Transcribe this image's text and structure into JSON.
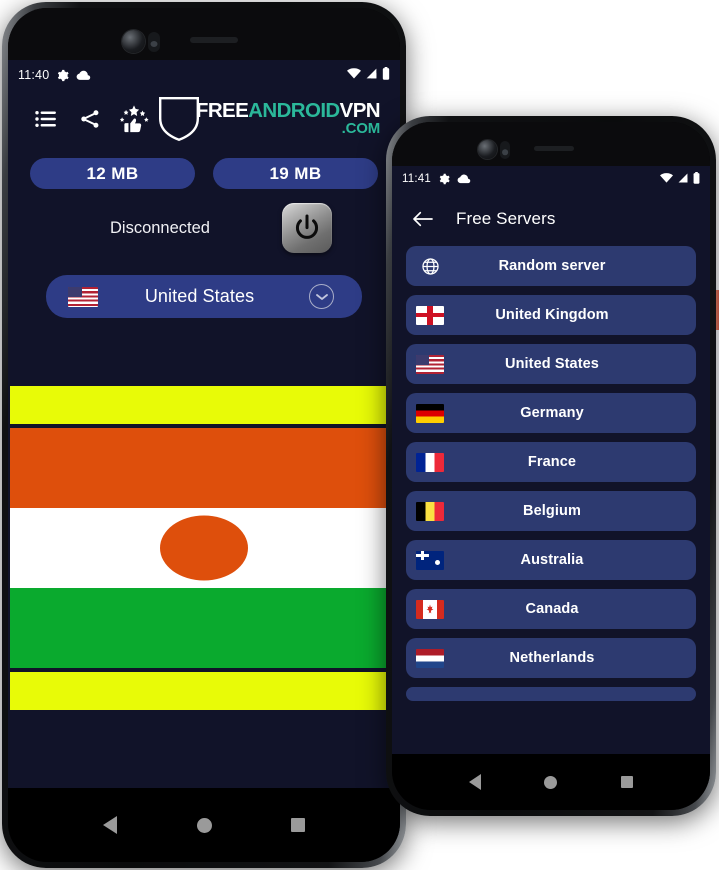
{
  "meta": {
    "bg_dark": "#111329",
    "accent_blue": "#2e3c86",
    "list_blue": "#2d3a70",
    "logo_teal": "#2bb89a"
  },
  "phone1": {
    "status_bar": {
      "time": "11:40",
      "icons": [
        "gear-icon",
        "cloud-icon",
        "wifi-icon",
        "signal-icon",
        "battery-icon"
      ]
    },
    "toolbar": {
      "icons": [
        {
          "name": "menu-list-icon",
          "label": "Menu"
        },
        {
          "name": "share-icon",
          "label": "Share"
        },
        {
          "name": "rate-us-icon",
          "label": "Rate us"
        }
      ],
      "logo": {
        "line1_free": "FREE",
        "line1_android": "ANDROID",
        "line1_vpn": "VPN",
        "line2": ".COM"
      }
    },
    "stats": {
      "download": "12 MB",
      "upload": "19 MB"
    },
    "connection": {
      "status": "Disconnected",
      "power_button": "power-toggle"
    },
    "country_selector": {
      "flag": "us-flag",
      "name": "United States",
      "chevron": "chevron-down-icon"
    },
    "banner": {
      "flag": "niger-flag",
      "band_color": "#e8fb07",
      "stripe_top": "#de4f0c",
      "stripe_mid": "#ffffff",
      "stripe_bottom": "#0aaa2e",
      "disc_color": "#de4f0c"
    },
    "nav_bar": [
      "back-button",
      "home-button",
      "recents-button"
    ]
  },
  "phone2": {
    "status_bar": {
      "time": "11:41",
      "icons": [
        "gear-icon",
        "cloud-icon",
        "wifi-icon",
        "signal-icon",
        "battery-icon"
      ]
    },
    "app_bar": {
      "back": "back-arrow-icon",
      "title": "Free Servers"
    },
    "servers": [
      {
        "flag": "globe-icon",
        "name": "Random server"
      },
      {
        "flag": "en-flag",
        "name": "United Kingdom"
      },
      {
        "flag": "us-flag",
        "name": "United States"
      },
      {
        "flag": "de-flag",
        "name": "Germany"
      },
      {
        "flag": "fr-flag",
        "name": "France"
      },
      {
        "flag": "be-flag",
        "name": "Belgium"
      },
      {
        "flag": "au-flag",
        "name": "Australia"
      },
      {
        "flag": "ca-flag",
        "name": "Canada"
      },
      {
        "flag": "nl-flag",
        "name": "Netherlands"
      },
      {
        "flag": "",
        "name": ""
      }
    ],
    "nav_bar": [
      "back-button",
      "home-button",
      "recents-button"
    ]
  }
}
